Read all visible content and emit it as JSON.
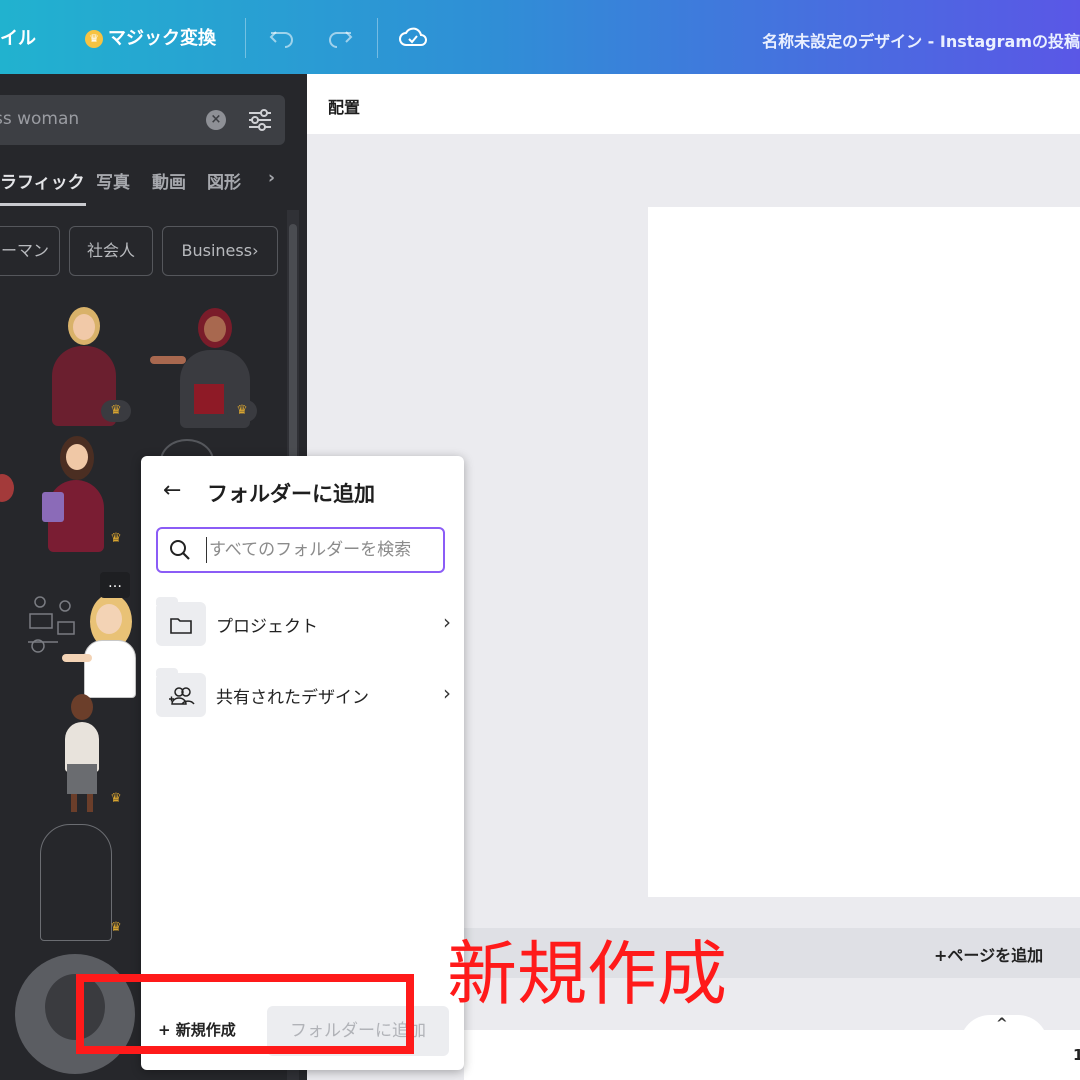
{
  "topbar": {
    "file_label": "イル",
    "magic_label": "マジック変換",
    "doc_title": "名称未設定のデザイン - Instagramの投稿"
  },
  "left_panel": {
    "search_value": "ss woman",
    "tabs": [
      "ラフィック",
      "写真",
      "動画",
      "図形"
    ],
    "chips": [
      "ーマン",
      "社会人",
      "Business"
    ]
  },
  "toolbar": {
    "arrange_label": "配置"
  },
  "canvas": {
    "add_page_label": "+ページを追加",
    "page_number": "1"
  },
  "popup": {
    "title": "フォルダーに追加",
    "search_placeholder": "すべてのフォルダーを検索",
    "folders": [
      {
        "label": "プロジェクト",
        "icon": "folder-icon"
      },
      {
        "label": "共有されたデザイン",
        "icon": "shared-users-icon"
      }
    ],
    "new_create_label": "+ 新規作成",
    "add_button_label": "フォルダーに追加"
  },
  "annotation": {
    "text": "新規作成",
    "color": "#ff1a1a"
  },
  "colors": {
    "accent": "#8b5cf6",
    "crown": "#d9a530",
    "panel_bg": "#26272b"
  }
}
